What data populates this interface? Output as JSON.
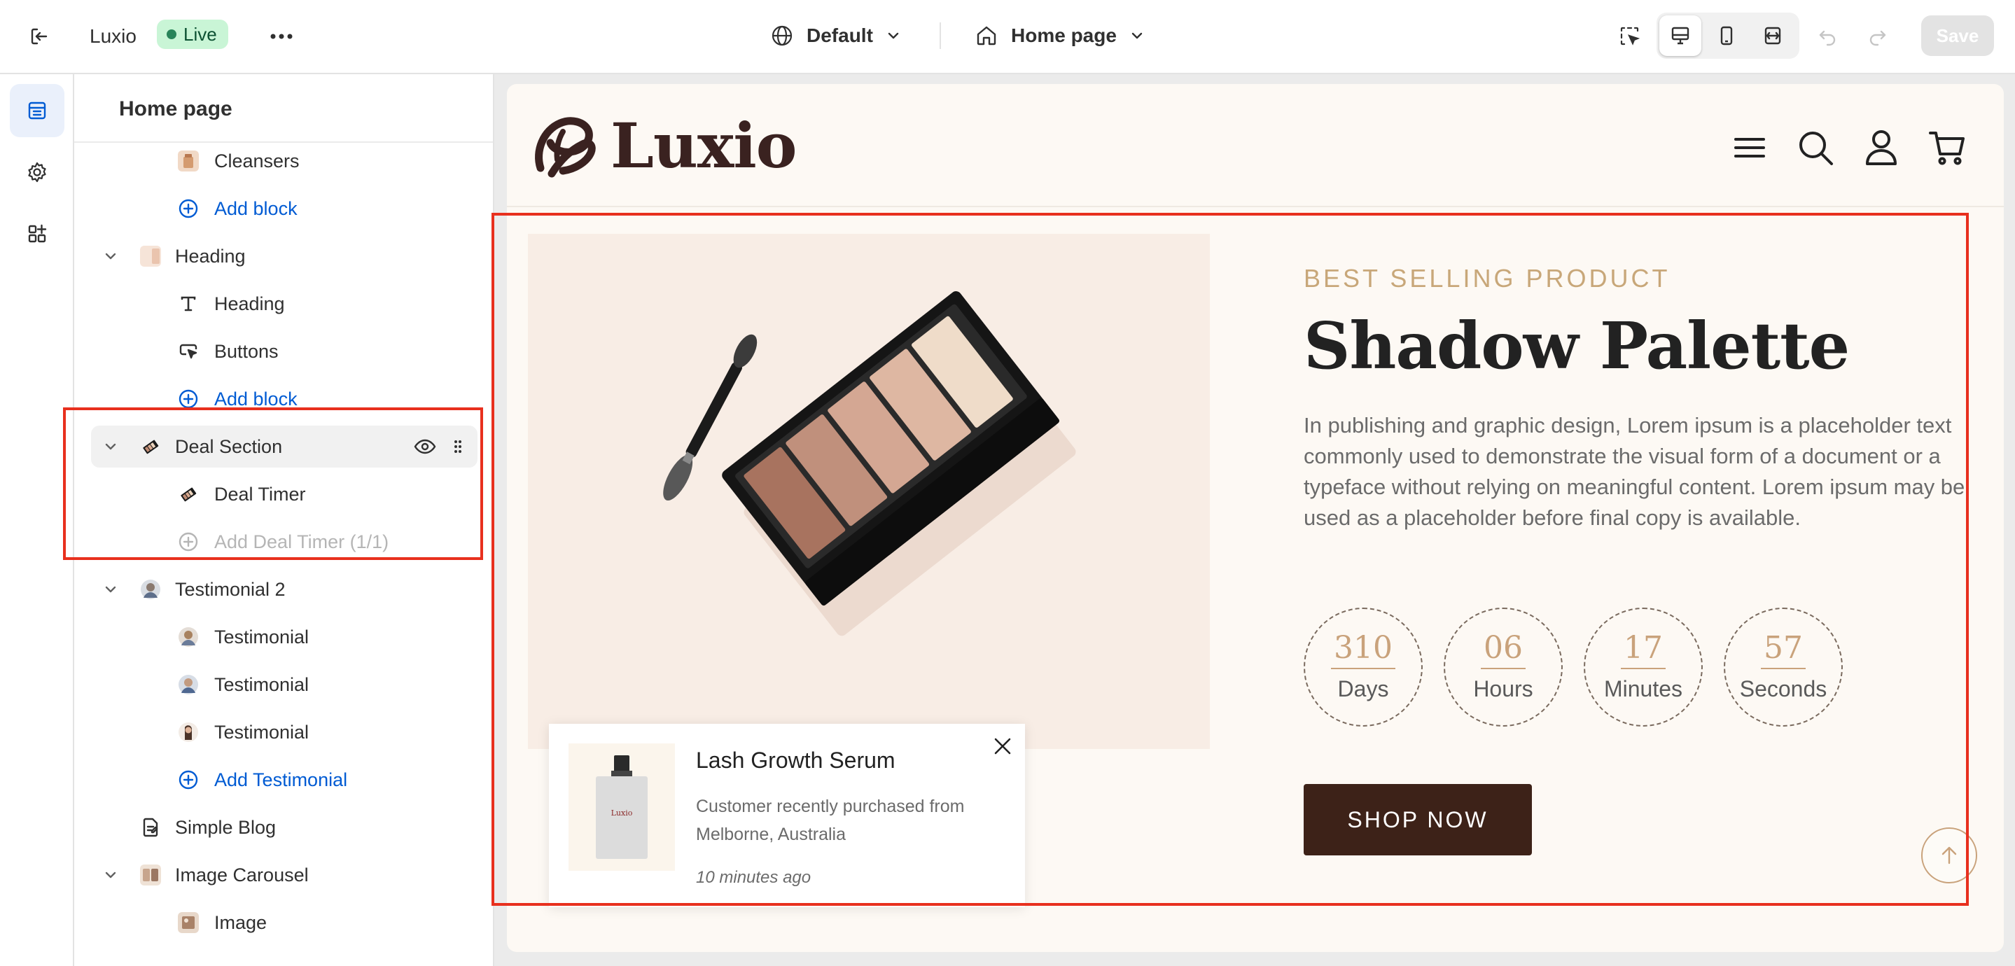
{
  "topbar": {
    "store_name": "Luxio",
    "status": "Live",
    "theme_label": "Default",
    "page_label": "Home page",
    "save_label": "Save"
  },
  "sidebar": {
    "title": "Home page",
    "rows": {
      "cleansers": "Cleansers",
      "add_block_1": "Add block",
      "heading_section": "Heading",
      "heading_block": "Heading",
      "buttons_block": "Buttons",
      "add_block_2": "Add block",
      "deal_section": "Deal Section",
      "deal_timer": "Deal Timer",
      "add_deal_timer": "Add Deal Timer (1/1)",
      "testimonial_section": "Testimonial 2",
      "testimonials": [
        "Testimonial",
        "Testimonial",
        "Testimonial"
      ],
      "add_testimonial": "Add Testimonial",
      "simple_blog": "Simple Blog",
      "image_carousel": "Image Carousel",
      "image_block": "Image"
    }
  },
  "preview": {
    "logo_text": "Luxio",
    "hero": {
      "kicker": "BEST SELLING PRODUCT",
      "title": "Shadow Palette",
      "description": "In publishing and graphic design, Lorem ipsum is a placeholder text commonly used to demonstrate the visual form of a document or a typeface without relying on meaningful content. Lorem ipsum may be used as a placeholder before final copy is available.",
      "button": "SHOP NOW"
    },
    "timer": {
      "days": "310",
      "days_label": "Days",
      "hours": "06",
      "hours_label": "Hours",
      "minutes": "17",
      "minutes_label": "Minutes",
      "seconds": "57",
      "seconds_label": "Seconds"
    },
    "popup": {
      "product": "Lash Growth Serum",
      "message": "Customer recently purchased  from Melborne, Australia",
      "time": "10 minutes ago",
      "bottle_label": "Luxio"
    }
  },
  "colors": {
    "accent_gold": "#c8a779",
    "button_brown": "#3d2218",
    "highlight_red": "#e8301e",
    "link_blue": "#005bd3",
    "live_green": "#29845a"
  }
}
